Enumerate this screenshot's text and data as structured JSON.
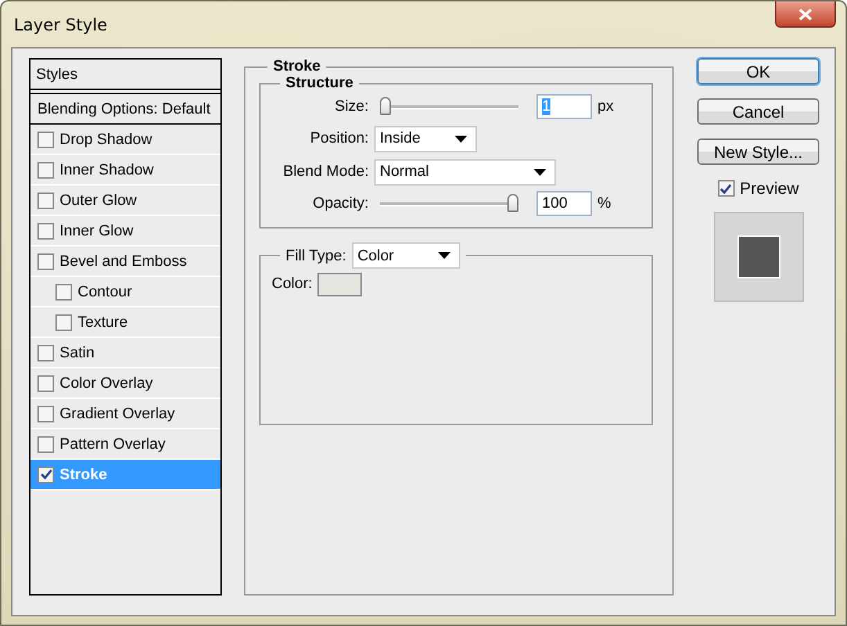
{
  "window": {
    "title": "Layer Style"
  },
  "styles_list": {
    "header": "Styles",
    "items": [
      {
        "label": "Blending Options: Default",
        "kind": "heading",
        "selected": false
      },
      {
        "label": "Drop Shadow",
        "kind": "option",
        "checked": false,
        "selected": false
      },
      {
        "label": "Inner Shadow",
        "kind": "option",
        "checked": false,
        "selected": false
      },
      {
        "label": "Outer Glow",
        "kind": "option",
        "checked": false,
        "selected": false
      },
      {
        "label": "Inner Glow",
        "kind": "option",
        "checked": false,
        "selected": false
      },
      {
        "label": "Bevel and Emboss",
        "kind": "option",
        "checked": false,
        "selected": false,
        "children": [
          {
            "label": "Contour",
            "kind": "option",
            "checked": false,
            "selected": false
          },
          {
            "label": "Texture",
            "kind": "option",
            "checked": false,
            "selected": false
          }
        ]
      },
      {
        "label": "Satin",
        "kind": "option",
        "checked": false,
        "selected": false
      },
      {
        "label": "Color Overlay",
        "kind": "option",
        "checked": false,
        "selected": false
      },
      {
        "label": "Gradient Overlay",
        "kind": "option",
        "checked": false,
        "selected": false
      },
      {
        "label": "Pattern Overlay",
        "kind": "option",
        "checked": false,
        "selected": false
      },
      {
        "label": "Stroke",
        "kind": "option",
        "checked": true,
        "selected": true
      }
    ]
  },
  "stroke_panel": {
    "title": "Stroke",
    "structure": {
      "title": "Structure",
      "size": {
        "label": "Size:",
        "level": 0,
        "value": "1",
        "unit": "px"
      },
      "position": {
        "label": "Position:",
        "value": "Inside"
      },
      "blend_mode": {
        "label": "Blend Mode:",
        "value": "Normal"
      },
      "opacity": {
        "label": "Opacity:",
        "level": 1,
        "value": "100",
        "unit": "%"
      }
    },
    "fill": {
      "label": "Fill Type:",
      "value": "Color",
      "color_label": "Color:",
      "color": "#e6e6e1"
    }
  },
  "buttons": [
    {
      "label": "OK",
      "default": true
    },
    {
      "label": "Cancel",
      "default": false
    },
    {
      "label": "New Style...",
      "default": false
    }
  ],
  "preview": {
    "label": "Preview",
    "checked": true
  }
}
